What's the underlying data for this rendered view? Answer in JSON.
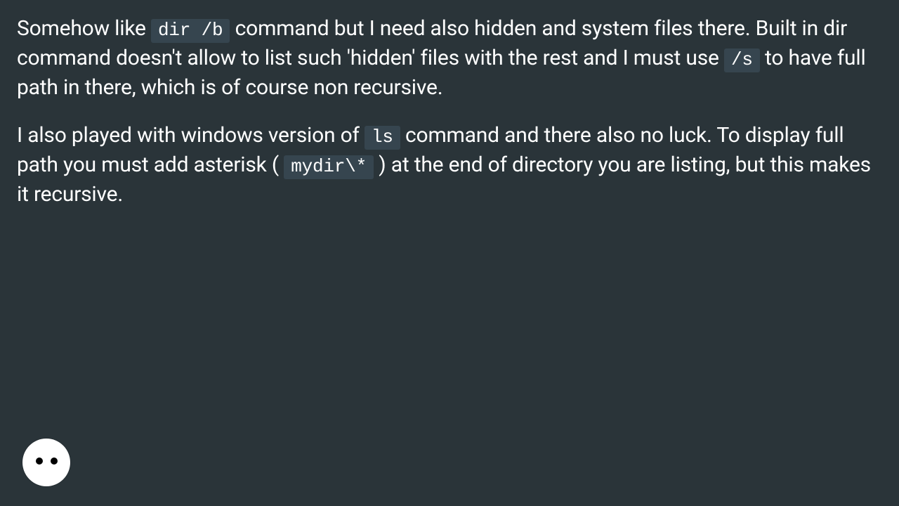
{
  "paragraphs": {
    "p1": {
      "s1": "Somehow like ",
      "c1": "dir /b",
      "s2": " command but I need also hidden and system files there. Built in dir command doesn't allow to list such 'hidden' files with the rest and I must use ",
      "c2": "/s",
      "s3": " to have full path in there, which is of course non recursive."
    },
    "p2": {
      "s1": "I also played with windows version of ",
      "c1": "ls",
      "s2": " command and there also no luck. To display full path you must add asterisk ( ",
      "c2": "mydir\\*",
      "s3": " ) at the end of directory you are listing, but this makes it recursive."
    }
  }
}
